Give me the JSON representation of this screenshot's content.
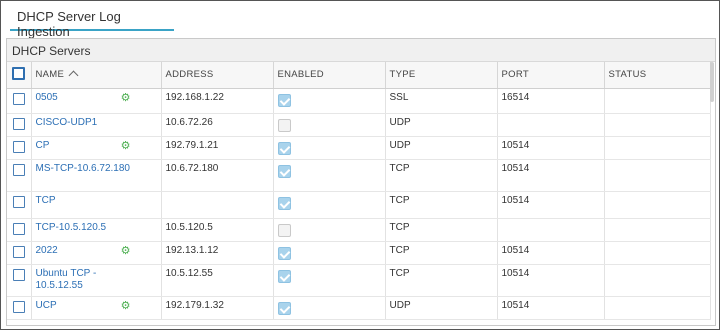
{
  "tab": {
    "label": "DHCP Server Log Ingestion"
  },
  "panel": {
    "title": "DHCP Servers"
  },
  "columns": {
    "name": "NAME",
    "address": "ADDRESS",
    "enabled": "ENABLED",
    "type": "TYPE",
    "port": "PORT",
    "status": "STATUS"
  },
  "rows": [
    {
      "name": "0505",
      "address": "192.168.1.22",
      "enabled": true,
      "type": "SSL",
      "port": "16514",
      "status": "",
      "gear": true
    },
    {
      "name": "CISCO-UDP1",
      "address": "10.6.72.26",
      "enabled": false,
      "type": "UDP",
      "port": "",
      "status": "",
      "gear": false
    },
    {
      "name": "CP",
      "address": "192.79.1.21",
      "enabled": true,
      "type": "UDP",
      "port": "10514",
      "status": "",
      "gear": true
    },
    {
      "name": "MS-TCP-10.6.72.180",
      "address": "10.6.72.180",
      "enabled": true,
      "type": "TCP",
      "port": "10514",
      "status": "",
      "gear": false
    },
    {
      "name": "TCP",
      "address": "",
      "enabled": true,
      "type": "TCP",
      "port": "10514",
      "status": "",
      "gear": false
    },
    {
      "name": "TCP-10.5.120.5",
      "address": "10.5.120.5",
      "enabled": false,
      "type": "TCP",
      "port": "",
      "status": "",
      "gear": false
    },
    {
      "name": "2022",
      "address": "192.13.1.12",
      "enabled": true,
      "type": "TCP",
      "port": "10514",
      "status": "",
      "gear": true
    },
    {
      "name": "Ubuntu TCP - 10.5.12.55",
      "address": "10.5.12.55",
      "enabled": true,
      "type": "TCP",
      "port": "10514",
      "status": "",
      "gear": false
    },
    {
      "name": "UCP",
      "address": "192.179.1.32",
      "enabled": true,
      "type": "UDP",
      "port": "10514",
      "status": "",
      "gear": true
    }
  ],
  "icons": {
    "gear": "gear-icon",
    "sort": "sort-ascending-icon"
  },
  "colors": {
    "link": "#2c6fb5",
    "gear": "#4caf50",
    "tab_underline": "#3aa3c6",
    "checked": "#a9d3ec"
  }
}
